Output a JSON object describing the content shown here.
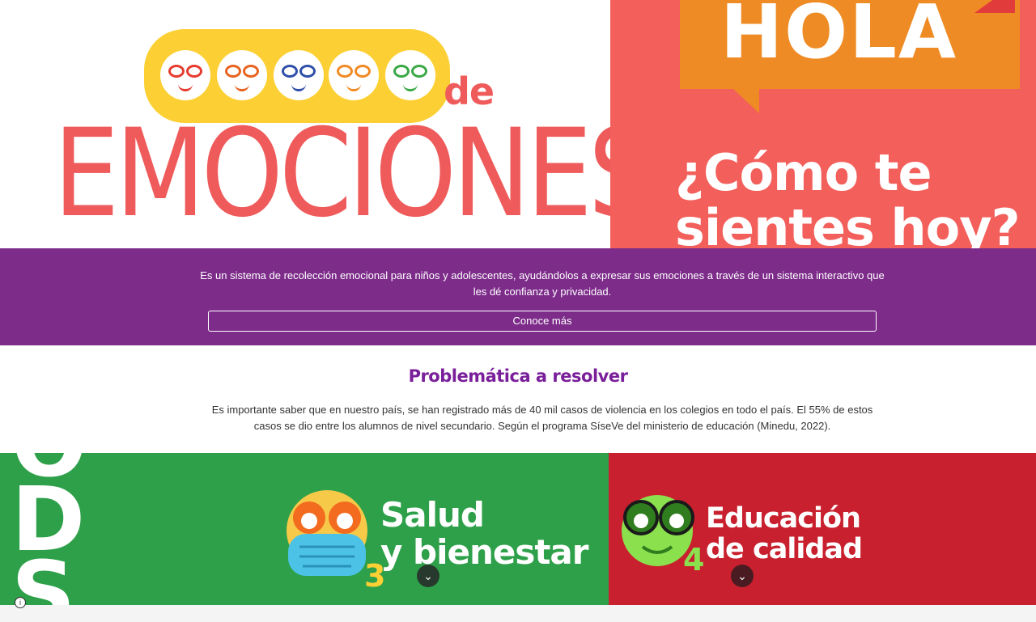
{
  "hero": {
    "logo_top": "de",
    "logo_word": "EMOCIONES",
    "hola": "HOLA",
    "question_line1": "¿Cómo te",
    "question_line2": "sientes hoy?",
    "colors": {
      "pill": "#fcd034",
      "coral": "#ef5b5b",
      "orange": "#ef8b24"
    },
    "faces": [
      {
        "icon": "happy-face-icon",
        "color": "#e63b2e"
      },
      {
        "icon": "angry-face-icon",
        "color": "#e8621e"
      },
      {
        "icon": "sad-face-icon",
        "color": "#2f4fa8"
      },
      {
        "icon": "surprised-face-icon",
        "color": "#f08a24"
      },
      {
        "icon": "calm-face-icon",
        "color": "#3aa845"
      }
    ]
  },
  "intro": {
    "text": "Es un sistema de recolección emocional para niños y adolescentes, ayudándolos a expresar sus emociones a través de un sistema interactivo que les dé confianza y privacidad.",
    "button": "Conoce más",
    "bg": "#7d2c8a"
  },
  "problem": {
    "title": "Problemática a resolver",
    "text": "Es importante saber que en nuestro país, se han registrado más de 40 mil casos de violencia en los colegios en todo el país. El 55% de estos casos se dio entre los alumnos de nivel secundario. Según el programa SíseVe del ministerio de educación (Minedu, 2022)."
  },
  "ods": {
    "letters": [
      "O",
      "D",
      "S"
    ],
    "cards": [
      {
        "line1": "Salud",
        "line2": "y bienestar",
        "number": "3",
        "bg": "#2ea04a"
      },
      {
        "line1": "Educación",
        "line2": "de calidad",
        "number": "4",
        "bg": "#c8202e"
      }
    ]
  },
  "footer": {
    "info_icon": "info-icon"
  }
}
